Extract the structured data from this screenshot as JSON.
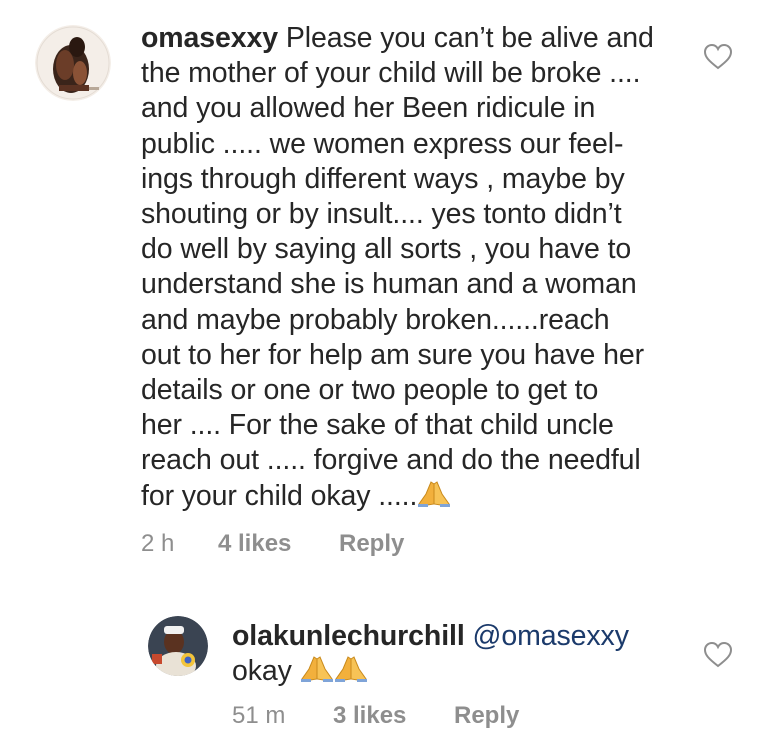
{
  "comments": [
    {
      "username": "omasexxy",
      "avatar_icon": "profile-photo-omasexxy",
      "lines": [
        " Please you can’t be alive and",
        "the mother of your child will be broke ....",
        "and you allowed her Been  ridicule in",
        "public ..... we women express our feel-",
        "ings through different ways , maybe by",
        "shouting or by insult.... yes tonto didn’t",
        "do well by saying all sorts , you have to",
        "understand she is human and a woman",
        "and  maybe probably broken......reach",
        "out to her for help am sure you have her",
        "details or one or two people to get to",
        "her .... For the sake of that child uncle",
        "reach out ..... forgive and do the needful",
        "for your child okay ....."
      ],
      "emoji": "praying-hands-emoji",
      "time": "2 h",
      "likes": "4 likes",
      "reply_label": "Reply",
      "like_icon": "heart-outline-icon"
    },
    {
      "username": "olakunlechurchill",
      "avatar_icon": "profile-photo-olakunlechurchill",
      "mention": " @omasexxy",
      "text": "okay ",
      "emoji": "praying-hands-emoji",
      "time": "51 m",
      "likes": "3 likes",
      "reply_label": "Reply",
      "like_icon": "heart-outline-icon"
    }
  ],
  "colors": {
    "text": "#262626",
    "meta": "#8e8e8e",
    "mention": "#1b3a6b",
    "emoji": "#f2b03c"
  }
}
